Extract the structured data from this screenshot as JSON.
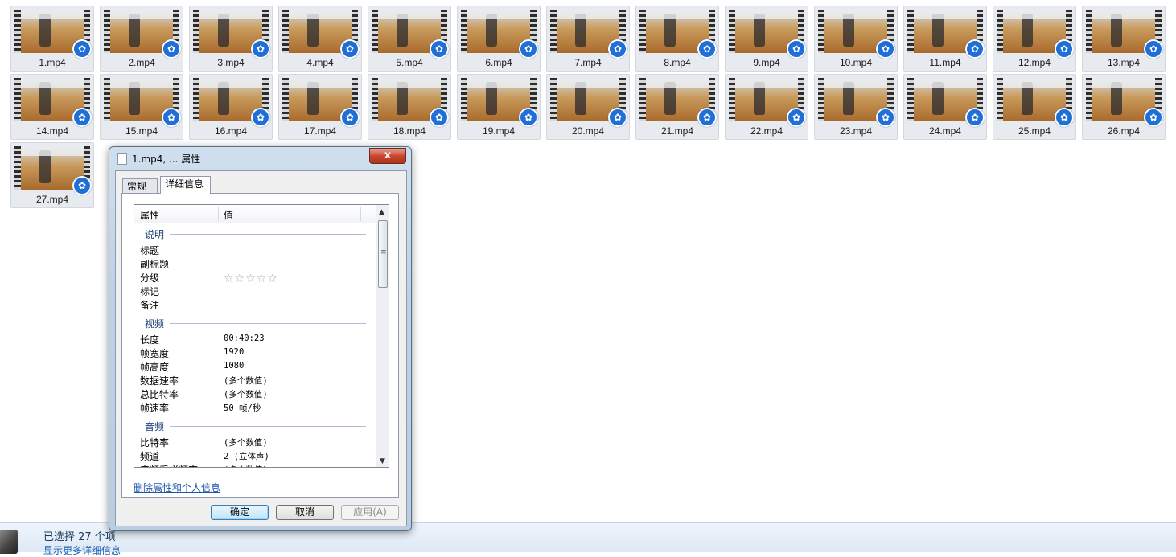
{
  "files": [
    "1.mp4",
    "2.mp4",
    "3.mp4",
    "4.mp4",
    "5.mp4",
    "6.mp4",
    "7.mp4",
    "8.mp4",
    "9.mp4",
    "10.mp4",
    "11.mp4",
    "12.mp4",
    "13.mp4",
    "14.mp4",
    "15.mp4",
    "16.mp4",
    "17.mp4",
    "18.mp4",
    "19.mp4",
    "20.mp4",
    "21.mp4",
    "22.mp4",
    "23.mp4",
    "24.mp4",
    "25.mp4",
    "26.mp4",
    "27.mp4"
  ],
  "file_overlay_icon": "media-player-icon",
  "dialog": {
    "title": "1.mp4, ... 属性",
    "close_label": "x",
    "tabs": [
      "常规",
      "详细信息"
    ],
    "active_tab": "详细信息",
    "columns": {
      "property": "属性",
      "value": "值"
    },
    "groups": {
      "description": {
        "heading": "说明",
        "props": [
          "标题",
          "副标题",
          "分级",
          "标记",
          "备注"
        ],
        "rating_stars": "☆☆☆☆☆"
      },
      "video": {
        "heading": "视频",
        "rows": [
          {
            "name": "长度",
            "value": "00:40:23"
          },
          {
            "name": "帧宽度",
            "value": "1920"
          },
          {
            "name": "帧高度",
            "value": "1080"
          },
          {
            "name": "数据速率",
            "value": "(多个数值)"
          },
          {
            "name": "总比特率",
            "value": "(多个数值)"
          },
          {
            "name": "帧速率",
            "value": "50 帧/秒"
          }
        ]
      },
      "audio": {
        "heading": "音频",
        "rows": [
          {
            "name": "比特率",
            "value": "(多个数值)"
          },
          {
            "name": "频道",
            "value": "2 (立体声)"
          },
          {
            "name": "音频采样频率",
            "value": "(多个数值)"
          }
        ]
      }
    },
    "remove_link": "删除属性和个人信息",
    "buttons": {
      "ok": "确定",
      "cancel": "取消",
      "apply": "应用(A)"
    }
  },
  "status": {
    "selected_text": "已选择 27 个项",
    "more_details": "显示更多详细信息"
  },
  "colors": {
    "accent": "#1f6fd6",
    "link": "#1f56a8",
    "close": "#c9462f"
  }
}
